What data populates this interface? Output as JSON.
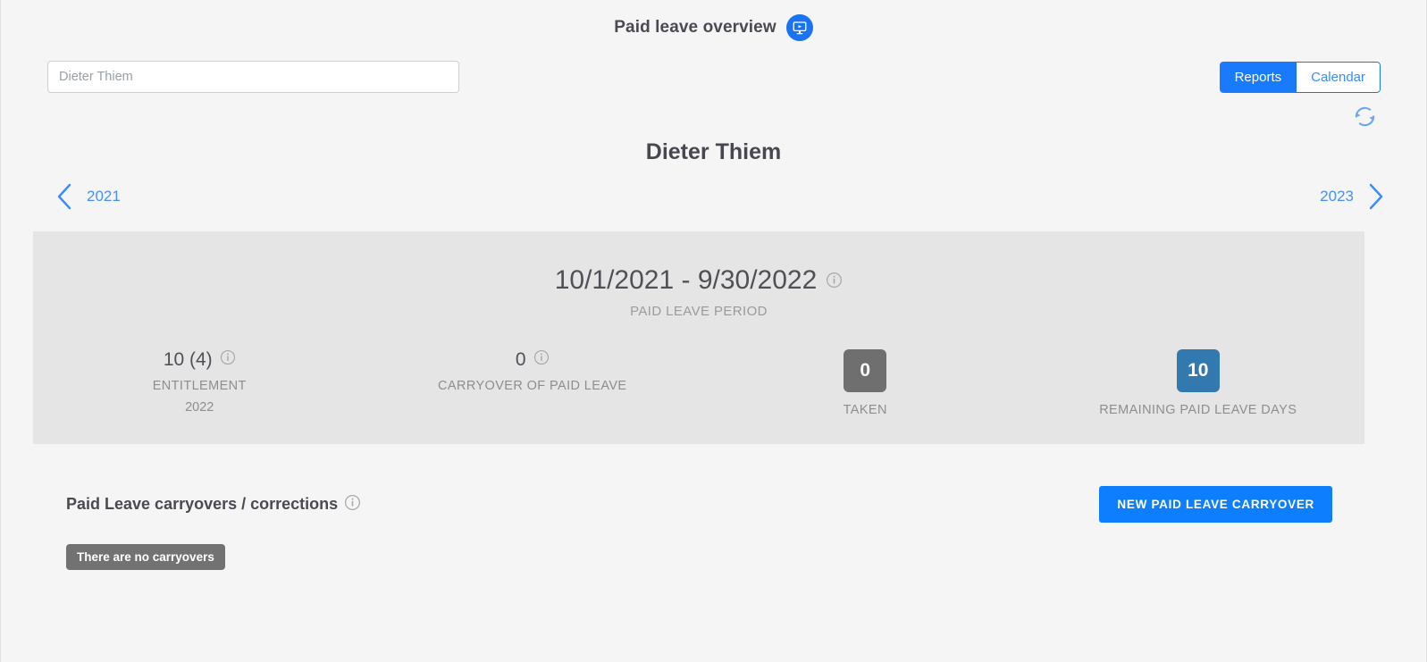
{
  "header": {
    "title": "Paid leave overview",
    "video_icon": "monitor-play-icon"
  },
  "toolbar": {
    "search_value": "Dieter Thiem",
    "search_placeholder": "Dieter Thiem",
    "view_toggle": {
      "options": [
        "Reports",
        "Calendar"
      ],
      "active": "Reports",
      "reports_label": "Reports",
      "calendar_label": "Calendar"
    },
    "refresh_icon": "refresh-icon"
  },
  "person": {
    "name": "Dieter Thiem"
  },
  "year_nav": {
    "previous_year": "2021",
    "next_year": "2023",
    "prev_icon": "chevron-left-icon",
    "next_icon": "chevron-right-icon"
  },
  "summary": {
    "period": "10/1/2021 - 9/30/2022",
    "period_label": "PAID LEAVE PERIOD",
    "stats": [
      {
        "value": "10 (4)",
        "label": "ENTITLEMENT",
        "sub": "2022",
        "has_info": true
      },
      {
        "value": "0",
        "label": "CARRYOVER OF PAID LEAVE",
        "sub": "",
        "has_info": true
      }
    ],
    "taken": {
      "value": "0",
      "label": "TAKEN",
      "color": "#6f6f6f"
    },
    "remaining": {
      "value": "10",
      "label": "REMAINING PAID LEAVE DAYS",
      "color": "#3179ae"
    }
  },
  "carryovers": {
    "title": "Paid Leave carryovers / corrections",
    "new_button": "NEW PAID LEAVE CARRYOVER",
    "empty_message": "There are no carryovers"
  },
  "colors": {
    "accent_blue": "#0d7efd",
    "toggle_blue": "#1a7afc",
    "panel_gray": "#e5e5e5",
    "page_bg": "#f5f5f5",
    "badge_gray": "#6f6f6f",
    "badge_blue": "#3179ae"
  }
}
